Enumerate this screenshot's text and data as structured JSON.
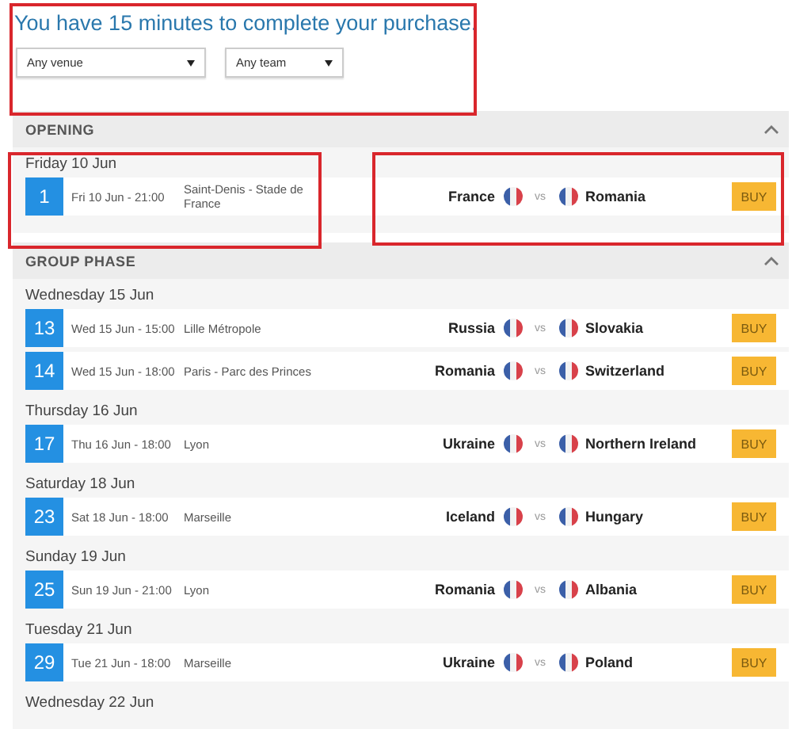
{
  "title": "You have 15 minutes to complete your purchase.",
  "filters": [
    {
      "value": "Any venue"
    },
    {
      "value": "Any team"
    }
  ],
  "sections": [
    {
      "title": "OPENING",
      "expanded": true,
      "days": [
        {
          "label": "Friday 10 Jun",
          "matches": [
            {
              "number": "1",
              "datetime": "Fri 10 Jun - 21:00",
              "venue": "Saint-Denis - Stade de France",
              "home": "France",
              "vs": "vs",
              "away": "Romania",
              "button": "BUY"
            }
          ]
        }
      ]
    },
    {
      "title": "GROUP PHASE",
      "expanded": true,
      "days": [
        {
          "label": "Wednesday 15 Jun",
          "matches": [
            {
              "number": "13",
              "datetime": "Wed 15 Jun - 15:00",
              "venue": "Lille Métropole",
              "home": "Russia",
              "vs": "vs",
              "away": "Slovakia",
              "button": "BUY"
            },
            {
              "number": "14",
              "datetime": "Wed 15 Jun - 18:00",
              "venue": "Paris - Parc des Princes",
              "home": "Romania",
              "vs": "vs",
              "away": "Switzerland",
              "button": "BUY"
            }
          ]
        },
        {
          "label": "Thursday 16 Jun",
          "matches": [
            {
              "number": "17",
              "datetime": "Thu 16 Jun - 18:00",
              "venue": "Lyon",
              "home": "Ukraine",
              "vs": "vs",
              "away": "Northern Ireland",
              "button": "BUY"
            }
          ]
        },
        {
          "label": "Saturday 18 Jun",
          "matches": [
            {
              "number": "23",
              "datetime": "Sat 18 Jun - 18:00",
              "venue": "Marseille",
              "home": "Iceland",
              "vs": "vs",
              "away": "Hungary",
              "button": "BUY"
            }
          ]
        },
        {
          "label": "Sunday 19 Jun",
          "matches": [
            {
              "number": "25",
              "datetime": "Sun 19 Jun - 21:00",
              "venue": "Lyon",
              "home": "Romania",
              "vs": "vs",
              "away": "Albania",
              "button": "BUY"
            }
          ]
        },
        {
          "label": "Tuesday 21 Jun",
          "matches": [
            {
              "number": "29",
              "datetime": "Tue 21 Jun - 18:00",
              "venue": "Marseille",
              "home": "Ukraine",
              "vs": "vs",
              "away": "Poland",
              "button": "BUY"
            }
          ]
        },
        {
          "label": "Wednesday 22 Jun"
        }
      ]
    }
  ],
  "highlights": [
    {
      "kind": "filters"
    },
    {
      "kind": "first-day"
    },
    {
      "kind": "first-teams"
    }
  ]
}
